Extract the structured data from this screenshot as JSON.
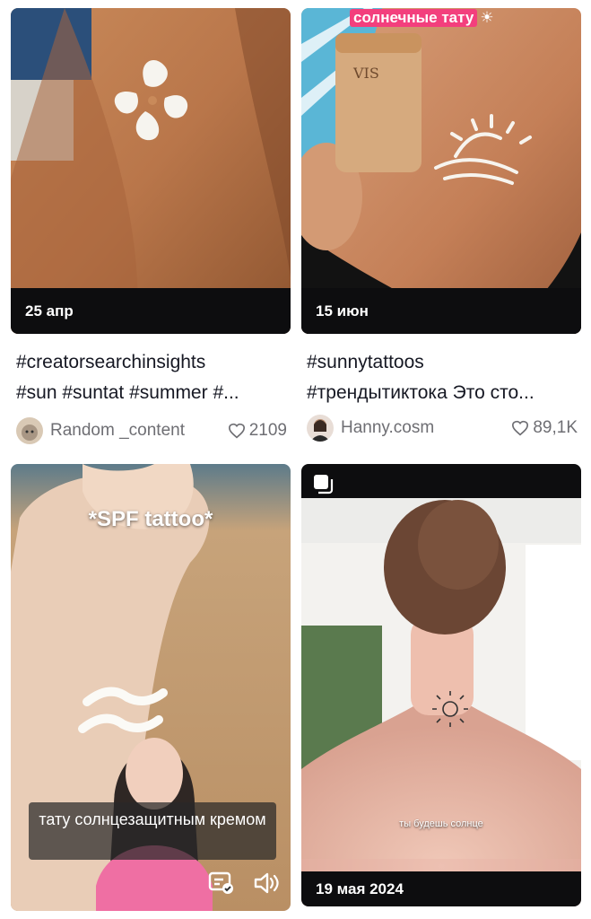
{
  "videos": [
    {
      "date": "25 апр",
      "caption_line1": "#creatorsearchinsights",
      "caption_line2": "#sun #suntat #summer #...",
      "author": "Random _content",
      "likes": "2109"
    },
    {
      "date": "15 июн",
      "sticker": "солнечные тату",
      "caption_line1": "#sunnytattoos",
      "caption_line2": "#трендытиктока Это сто...",
      "author": "Hanny.cosm",
      "likes": "89,1K"
    },
    {
      "overlay_title": "*SPF tattoo*",
      "subtitle": "тату солнцезащитным кремом",
      "icons": [
        "captions-icon",
        "volume-icon"
      ]
    },
    {
      "overlay_caption": "ты будешь солнце",
      "date": "19 мая 2024",
      "icons": [
        "multi-photo-icon"
      ]
    }
  ]
}
